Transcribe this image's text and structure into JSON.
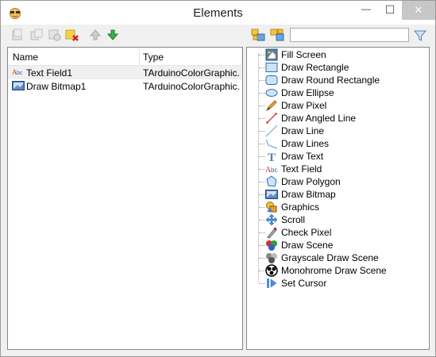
{
  "window": {
    "title": "Elements",
    "minimize_glyph": "—",
    "maximize_glyph": "☐",
    "close_glyph": "✕"
  },
  "toolbar": {
    "left_icons": [
      "add-element-icon",
      "copy-element-icon",
      "settings-element-icon",
      "delete-element-icon",
      "move-up-icon",
      "move-down-icon"
    ],
    "right_icons": [
      "expand-all-icon",
      "collapse-all-icon"
    ],
    "search_value": "",
    "filter_icon": "funnel-icon"
  },
  "table": {
    "columns": [
      "Name",
      "Type"
    ],
    "rows": [
      {
        "name": "Text Field1",
        "type": "TArduinoColorGraphicsTextField",
        "type_display": "TArduinoColorGraphic...",
        "icon": "text-field-icon",
        "selected": true
      },
      {
        "name": "Draw Bitmap1",
        "type": "TArduinoColorGraphicsDrawBitmap",
        "type_display": "TArduinoColorGraphic...",
        "icon": "draw-bitmap-icon",
        "selected": false
      }
    ]
  },
  "palette": {
    "items": [
      {
        "label": "Fill Screen",
        "icon": "fill-screen-icon"
      },
      {
        "label": "Draw Rectangle",
        "icon": "draw-rectangle-icon"
      },
      {
        "label": "Draw Round Rectangle",
        "icon": "draw-round-rectangle-icon"
      },
      {
        "label": "Draw Ellipse",
        "icon": "draw-ellipse-icon"
      },
      {
        "label": "Draw Pixel",
        "icon": "draw-pixel-icon"
      },
      {
        "label": "Draw Angled Line",
        "icon": "draw-angled-line-icon"
      },
      {
        "label": "Draw Line",
        "icon": "draw-line-icon"
      },
      {
        "label": "Draw Lines",
        "icon": "draw-lines-icon"
      },
      {
        "label": "Draw Text",
        "icon": "draw-text-icon"
      },
      {
        "label": "Text Field",
        "icon": "text-field-icon"
      },
      {
        "label": "Draw Polygon",
        "icon": "draw-polygon-icon"
      },
      {
        "label": "Draw Bitmap",
        "icon": "draw-bitmap-icon"
      },
      {
        "label": "Graphics",
        "icon": "graphics-icon"
      },
      {
        "label": "Scroll",
        "icon": "scroll-icon"
      },
      {
        "label": "Check Pixel",
        "icon": "check-pixel-icon"
      },
      {
        "label": "Draw Scene",
        "icon": "draw-scene-icon"
      },
      {
        "label": "Grayscale Draw Scene",
        "icon": "grayscale-draw-scene-icon"
      },
      {
        "label": "Monohrome Draw Scene",
        "icon": "monochrome-draw-scene-icon"
      },
      {
        "label": "Set Cursor",
        "icon": "set-cursor-icon"
      }
    ]
  },
  "colors": {
    "accent_blue": "#3c78c8",
    "delete_red": "#d02020",
    "arrow_green": "#30a030",
    "selection_gray": "#f0f0f0"
  }
}
